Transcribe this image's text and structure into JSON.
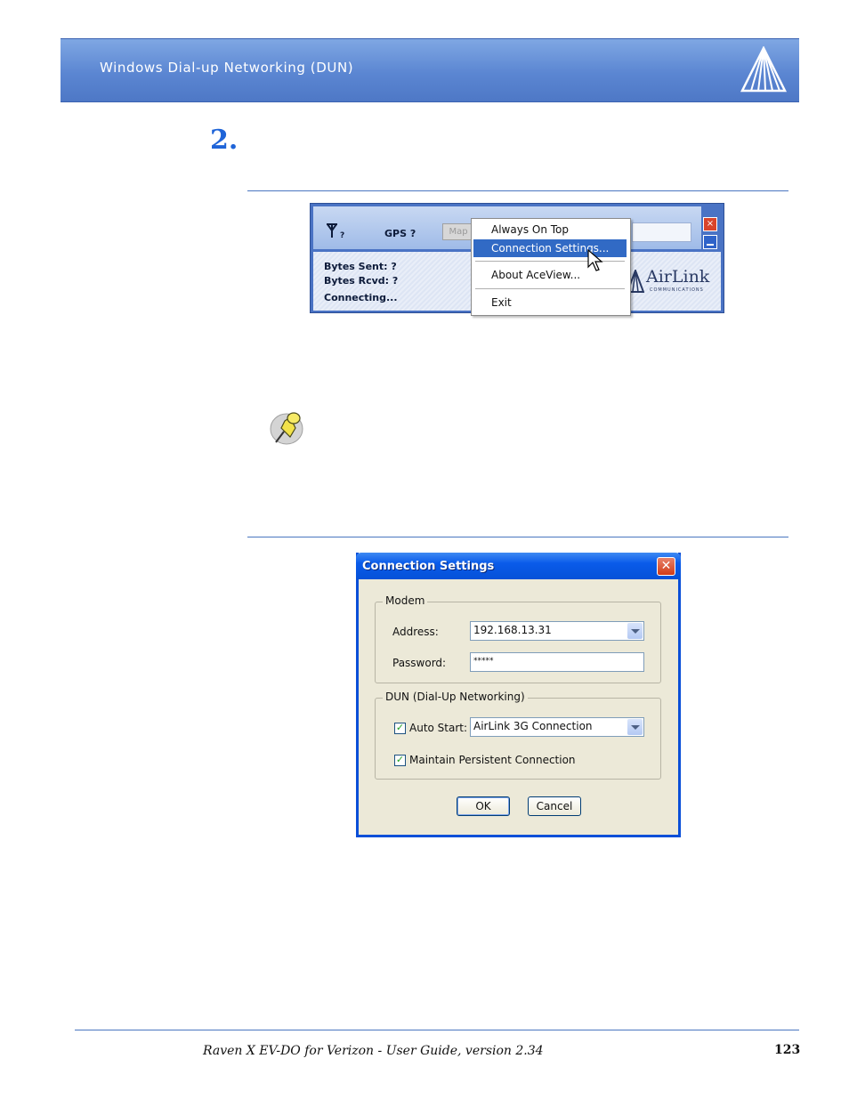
{
  "header": {
    "title": "Windows Dial-up Networking (DUN)",
    "logo_icon": "airlink-mountain-logo"
  },
  "step": {
    "number": "2."
  },
  "aceview": {
    "gps_label": "GPS ?",
    "signal_label": "?",
    "map_button": "Map",
    "bytes_sent": "Bytes Sent: ?",
    "bytes_rcvd": "Bytes Rcvd: ?",
    "status": "Connecting...",
    "brand": "AirLink",
    "brand_sub": "COMMUNICATIONS",
    "close_glyph": "×"
  },
  "context_menu": {
    "items": [
      "Always On Top",
      "Connection Settings...",
      "About AceView...",
      "Exit"
    ],
    "selected_index": 1
  },
  "note": {
    "icon": "pushpin-icon"
  },
  "dialog": {
    "title": "Connection Settings",
    "close_glyph": "✕",
    "modem_group": "Modem",
    "address_label": "Address:",
    "address_value": "192.168.13.31",
    "password_label": "Password:",
    "password_value": "*****",
    "dun_group": "DUN (Dial-Up Networking)",
    "auto_start_label": "Auto Start:",
    "auto_start_checked": true,
    "auto_start_value": "AirLink 3G Connection",
    "persistent_label": "Maintain Persistent Connection",
    "persistent_checked": true,
    "ok_label": "OK",
    "cancel_label": "Cancel",
    "check_glyph": "✓"
  },
  "footer": {
    "text": "Raven X EV-DO for Verizon - User Guide, version 2.34",
    "page": "123"
  }
}
